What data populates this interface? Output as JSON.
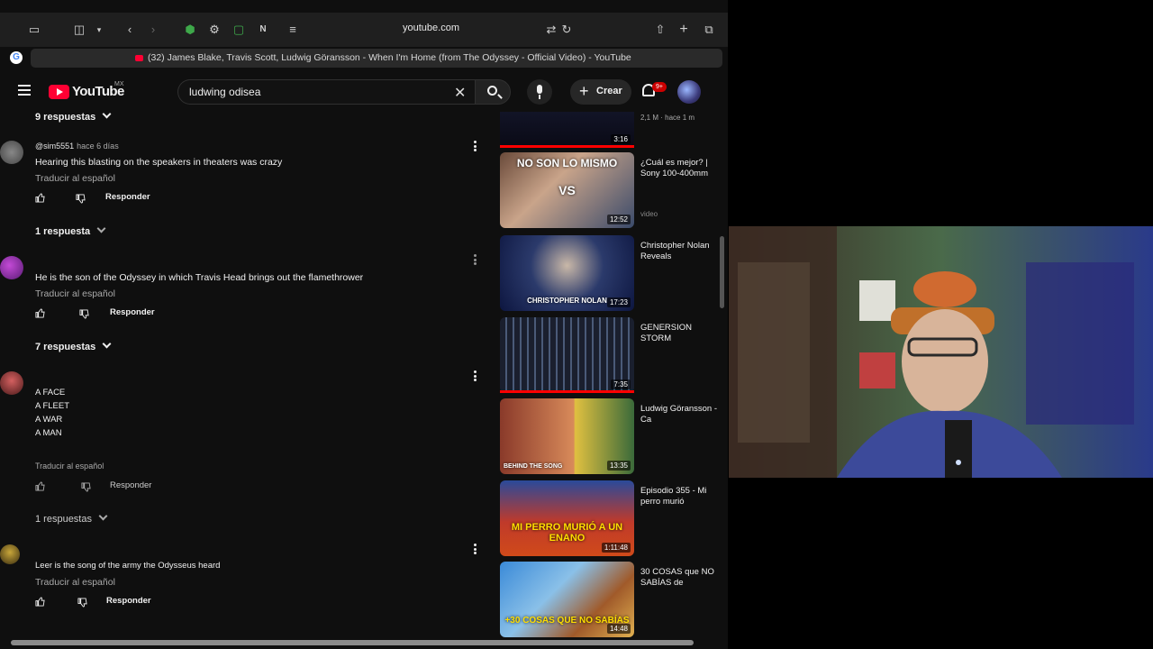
{
  "browser": {
    "url": "youtube.com",
    "tab_title": "(32) James Blake, Travis Scott, Ludwig Göransson - When I'm Home (from The Odyssey - Official Video) - YouTube"
  },
  "header": {
    "logo_text": "YouTube",
    "country_code": "MX",
    "search_value": "ludwing odisea",
    "create_label": "Crear",
    "notification_badge": "9+"
  },
  "comments": [
    {
      "type": "replies_toggle",
      "label": "9 respuestas"
    },
    {
      "type": "comment",
      "author": "@sim5551",
      "time": "hace 6 días",
      "text": "Hearing this blasting on the speakers in theaters was crazy",
      "translate": "Traducir al español",
      "reply": "Responder"
    },
    {
      "type": "replies_toggle",
      "label": "1 respuesta"
    },
    {
      "type": "comment",
      "text": "He is the son of the Odyssey in which Travis Head brings out the flamethrower",
      "translate": "Traducir al español",
      "reply": "Responder"
    },
    {
      "type": "replies_toggle",
      "label": "7 respuestas"
    },
    {
      "type": "comment",
      "lines": [
        "A FACE",
        "A FLEET",
        "A WAR",
        "A MAN"
      ],
      "translate": "Traducir al español",
      "reply": "Responder"
    },
    {
      "type": "replies_toggle",
      "label": "1 respuestas"
    },
    {
      "type": "comment",
      "text": "Leer is the song of the army the Odysseus heard",
      "translate": "Traducir al español",
      "reply": "Responder"
    }
  ],
  "related": [
    {
      "duration": "3:16",
      "meta_top": "2,1 M · hace 1 m"
    },
    {
      "title": "¿Cuál es mejor? | Sony 100-400mm",
      "meta": "video",
      "duration": "12:52",
      "overlay": "NO SON LO MISMO",
      "overlay2": "VS"
    },
    {
      "title": "Christopher Nolan Reveals",
      "duration": "17:23",
      "overlay": "CHRISTOPHER NOLAN"
    },
    {
      "title": "GENERSION STORM",
      "duration": "7:35"
    },
    {
      "title": "Ludwig Göransson - Ca",
      "duration": "13:35",
      "overlay": "BEHIND THE SONG"
    },
    {
      "title": "Episodio 355 - Mi perro murió",
      "duration": "1:11:48",
      "overlay": "MI PERRO MURIÓ A UN ENANO"
    },
    {
      "title": "30 COSAS que NO SABÍAS de",
      "duration": "14:48",
      "overlay": "+30 COSAS QUE NO SABÍAS"
    }
  ],
  "colors": {
    "accent": "#ff0033",
    "background": "#0f0f0f"
  }
}
